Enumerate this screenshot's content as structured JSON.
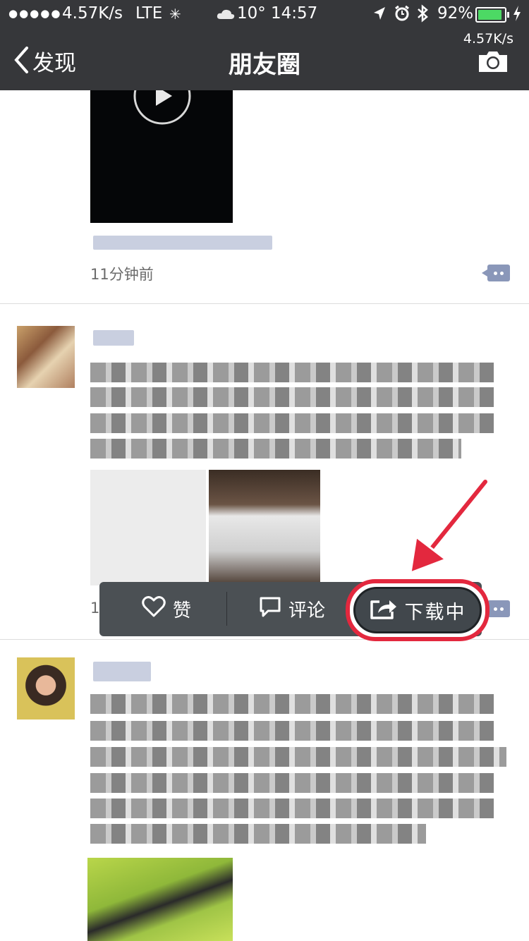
{
  "status_bar": {
    "net_speed": "4.57K/s",
    "carrier": "LTE",
    "weather": "10°",
    "time": "14:57",
    "battery": "92%",
    "battery_level": 0.92,
    "battery_color": "#4cd964"
  },
  "nav": {
    "back_label": "发现",
    "title": "朋友圈",
    "speed_overlay": "4.57K/s",
    "right_icon": "camera-icon"
  },
  "posts": [
    {
      "time": "11分钟前",
      "media": "video",
      "icons": [
        "play-icon",
        "comment-icon"
      ]
    },
    {
      "time": "1",
      "media": "image",
      "icons": [
        "comment-icon"
      ]
    },
    {
      "media": "image"
    }
  ],
  "action_popup": {
    "like_label": "赞",
    "comment_label": "评论",
    "download_label": "下载中",
    "icons": [
      "heart-icon",
      "comment-bubble-icon",
      "share-icon"
    ],
    "highlight_color": "#e3283e"
  },
  "colors": {
    "header_bg": "#36373a",
    "popup_bg": "#4b5054",
    "link_blue": "#8a97b9"
  }
}
